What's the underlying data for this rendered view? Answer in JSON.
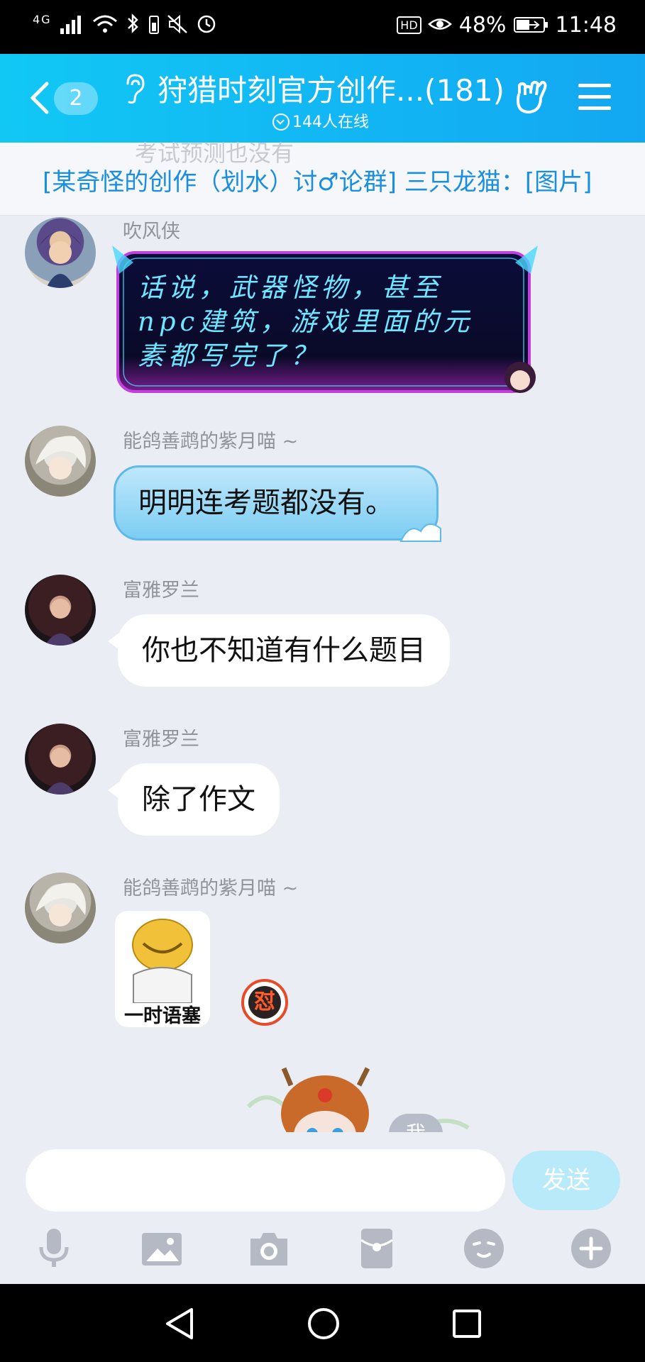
{
  "status_bar": {
    "network": "4G",
    "battery": "48%",
    "time": "11:48",
    "hd": "HD"
  },
  "header": {
    "back_badge": "2",
    "title": "狩猎时刻官方创作...(181)",
    "online": "144人在线"
  },
  "notice": {
    "ghost_text": "考试预测也没有",
    "text": "[某奇怪的创作（划水）讨♂论群] 三只龙猫：[图片]"
  },
  "messages": [
    {
      "sender": "吹风侠",
      "text": "话说，武器怪物，甚至npc建筑，游戏里面的元素都写完了？"
    },
    {
      "sender": "能鸽善鹉的紫月喵 ~",
      "text": "明明连考题都没有。"
    },
    {
      "sender": "富雅罗兰",
      "text": "你也不知道有什么题目"
    },
    {
      "sender": "富雅罗兰",
      "text": "除了作文"
    },
    {
      "sender": "能鸽善鹉的紫月喵 ~",
      "sticker_caption": "一时语塞",
      "badge": "怼"
    }
  ],
  "self_tag": "我",
  "input_bar": {
    "placeholder": "",
    "send_label": "发送"
  },
  "colors": {
    "header": "#13b4f3",
    "notice_text": "#1a8ee0",
    "send_button": "#b8eaf9",
    "background": "#eaedf4"
  }
}
